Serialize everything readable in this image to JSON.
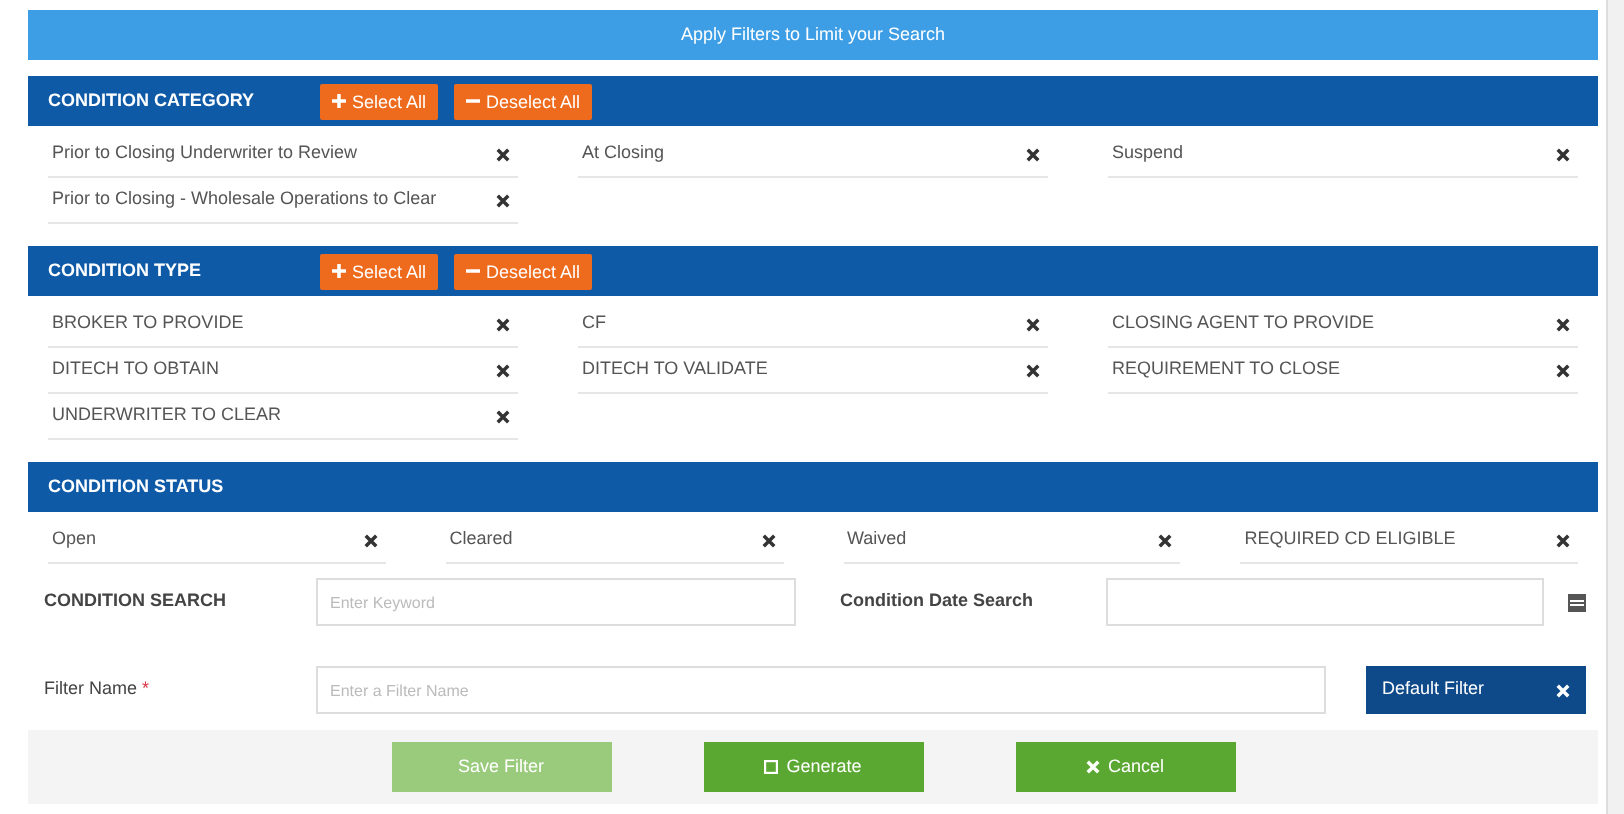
{
  "banner": {
    "title": "Apply Filters to Limit your Search"
  },
  "sections": [
    {
      "title": "CONDITION CATEGORY",
      "select_all": "Select All",
      "deselect_all": "Deselect All",
      "items": [
        {
          "label": "Prior to Closing Underwriter to Review"
        },
        {
          "label": "At Closing"
        },
        {
          "label": "Suspend"
        },
        {
          "label": "Prior to Closing - Wholesale Operations to Clear"
        }
      ]
    },
    {
      "title": "CONDITION TYPE",
      "select_all": "Select All",
      "deselect_all": "Deselect All",
      "items": [
        {
          "label": "BROKER TO PROVIDE"
        },
        {
          "label": "CF"
        },
        {
          "label": "CLOSING AGENT TO PROVIDE"
        },
        {
          "label": "DITECH TO OBTAIN"
        },
        {
          "label": "DITECH TO VALIDATE"
        },
        {
          "label": "REQUIREMENT TO CLOSE"
        },
        {
          "label": "UNDERWRITER TO CLEAR"
        }
      ]
    },
    {
      "title": "CONDITION STATUS",
      "items": [
        {
          "label": "Open"
        },
        {
          "label": "Cleared"
        },
        {
          "label": "Waived"
        },
        {
          "label": "REQUIRED CD ELIGIBLE"
        }
      ]
    }
  ],
  "search": {
    "label": "CONDITION SEARCH",
    "placeholder": "Enter Keyword",
    "date_label": "Condition Date Search"
  },
  "filter_name": {
    "label": "Filter Name",
    "required_mark": "*",
    "placeholder": "Enter a Filter Name",
    "tag": "Default Filter"
  },
  "buttons": [
    {
      "label": "Save Filter",
      "disabled": true
    },
    {
      "label": "Generate",
      "disabled": false
    },
    {
      "label": "Cancel",
      "disabled": false
    }
  ]
}
